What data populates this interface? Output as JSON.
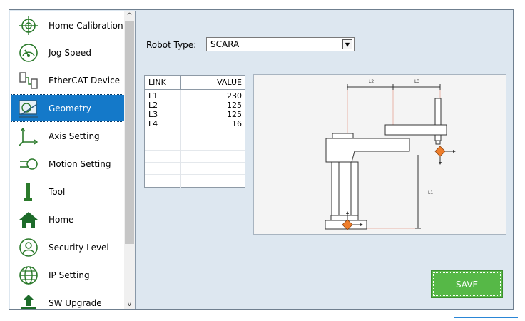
{
  "sidebar": {
    "items": [
      {
        "label": "Home Calibration",
        "icon": "crosshair-icon"
      },
      {
        "label": "Jog Speed",
        "icon": "speedometer-icon"
      },
      {
        "label": "EtherCAT Device",
        "icon": "ethercat-icon"
      },
      {
        "label": "Geometry",
        "icon": "geometry-icon",
        "selected": true
      },
      {
        "label": "Axis Setting",
        "icon": "axis-icon"
      },
      {
        "label": "Motion Setting",
        "icon": "motion-icon"
      },
      {
        "label": "Tool",
        "icon": "tool-icon"
      },
      {
        "label": "Home",
        "icon": "home-icon"
      },
      {
        "label": "Security Level",
        "icon": "user-icon"
      },
      {
        "label": "IP Setting",
        "icon": "globe-icon"
      },
      {
        "label": "SW Upgrade",
        "icon": "upload-icon"
      }
    ]
  },
  "robot_type": {
    "label": "Robot Type:",
    "value": "SCARA"
  },
  "link_table": {
    "headers": [
      "LINK",
      "VALUE"
    ],
    "rows": [
      {
        "link": "L1",
        "value": "230"
      },
      {
        "link": "L2",
        "value": "125"
      },
      {
        "link": "L3",
        "value": "125"
      },
      {
        "link": "L4",
        "value": "16"
      }
    ]
  },
  "diagram": {
    "labels": {
      "l1": "L1",
      "l2": "L2",
      "l3": "L3"
    }
  },
  "save_button": {
    "label": "SAVE"
  },
  "colors": {
    "accent": "#1479c9",
    "save": "#56b847",
    "marker": "#ef7d2a"
  }
}
